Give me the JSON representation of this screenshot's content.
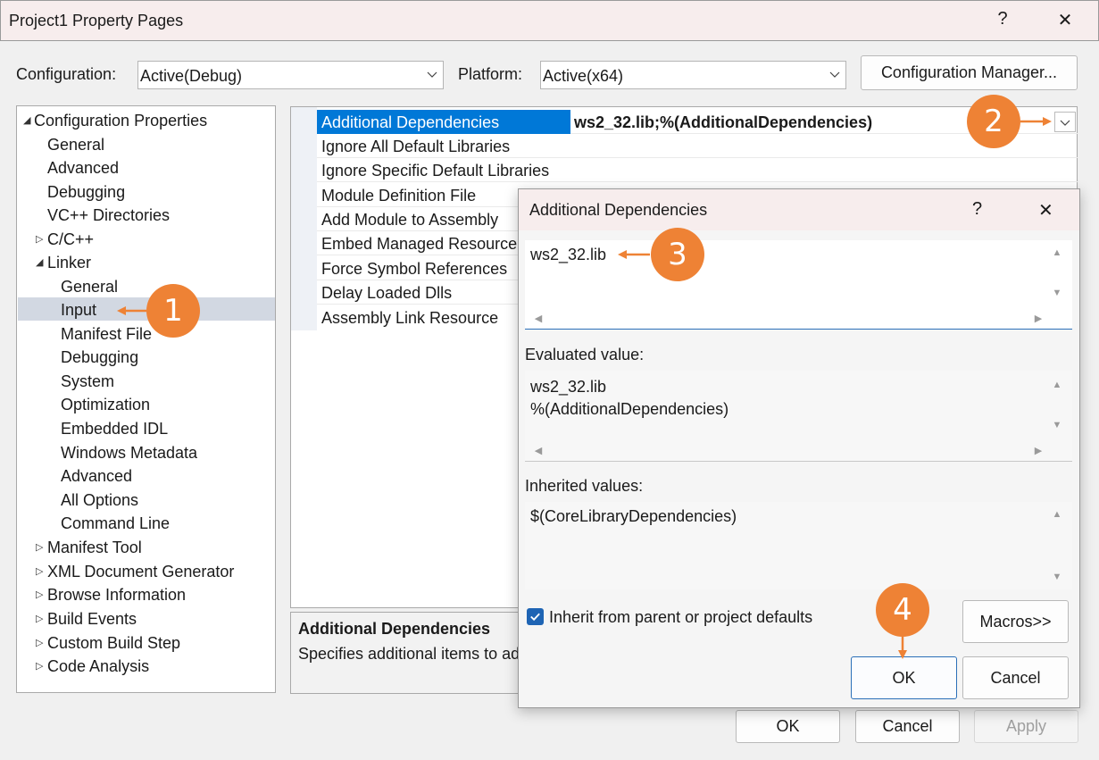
{
  "window": {
    "title": "Project1 Property Pages",
    "help": "?",
    "close": "✕"
  },
  "toolbar": {
    "configuration_label": "Configuration:",
    "configuration_value": "Active(Debug)",
    "platform_label": "Platform:",
    "platform_value": "Active(x64)",
    "config_manager_label": "Configuration Manager..."
  },
  "tree": {
    "items": [
      {
        "label": "Configuration Properties",
        "twisty": "◢"
      },
      {
        "label": "General"
      },
      {
        "label": "Advanced"
      },
      {
        "label": "Debugging"
      },
      {
        "label": "VC++ Directories"
      },
      {
        "label": "C/C++",
        "twisty": "▷"
      },
      {
        "label": "Linker",
        "twisty": "◢"
      },
      {
        "label": "General"
      },
      {
        "label": "Input"
      },
      {
        "label": "Manifest File"
      },
      {
        "label": "Debugging"
      },
      {
        "label": "System"
      },
      {
        "label": "Optimization"
      },
      {
        "label": "Embedded IDL"
      },
      {
        "label": "Windows Metadata"
      },
      {
        "label": "Advanced"
      },
      {
        "label": "All Options"
      },
      {
        "label": "Command Line"
      },
      {
        "label": "Manifest Tool",
        "twisty": "▷"
      },
      {
        "label": "XML Document Generator",
        "twisty": "▷"
      },
      {
        "label": "Browse Information",
        "twisty": "▷"
      },
      {
        "label": "Build Events",
        "twisty": "▷"
      },
      {
        "label": "Custom Build Step",
        "twisty": "▷"
      },
      {
        "label": "Code Analysis",
        "twisty": "▷"
      }
    ]
  },
  "grid": {
    "rows": [
      {
        "name": "Additional Dependencies",
        "value": "ws2_32.lib;%(AdditionalDependencies)"
      },
      {
        "name": "Ignore All Default Libraries",
        "value": ""
      },
      {
        "name": "Ignore Specific Default Libraries",
        "value": ""
      },
      {
        "name": "Module Definition File",
        "value": ""
      },
      {
        "name": "Add Module to Assembly",
        "value": ""
      },
      {
        "name": "Embed Managed Resource File",
        "value": ""
      },
      {
        "name": "Force Symbol References",
        "value": ""
      },
      {
        "name": "Delay Loaded Dlls",
        "value": ""
      },
      {
        "name": "Assembly Link Resource",
        "value": ""
      }
    ]
  },
  "description": {
    "title": "Additional Dependencies",
    "text": "Specifies additional items to add to the link command line"
  },
  "buttons": {
    "ok": "OK",
    "cancel": "Cancel",
    "apply": "Apply"
  },
  "dialog": {
    "title": "Additional Dependencies",
    "help": "?",
    "close": "✕",
    "edit_value": "ws2_32.lib",
    "evaluated_label": "Evaluated value:",
    "evaluated_lines": [
      "ws2_32.lib",
      "%(AdditionalDependencies)"
    ],
    "inherited_label": "Inherited values:",
    "inherited_lines": [
      "$(CoreLibraryDependencies)"
    ],
    "inherit_checkbox_label": "Inherit from parent or project defaults",
    "inherit_checked": true,
    "macros_label": "Macros>>",
    "ok": "OK",
    "cancel": "Cancel"
  },
  "callouts": [
    "1",
    "2",
    "3",
    "4"
  ],
  "colors": {
    "accent": "#ee8235",
    "selection": "#0078d7",
    "tree_selection": "#d2d8e2",
    "title_bar": "#f7eded"
  }
}
